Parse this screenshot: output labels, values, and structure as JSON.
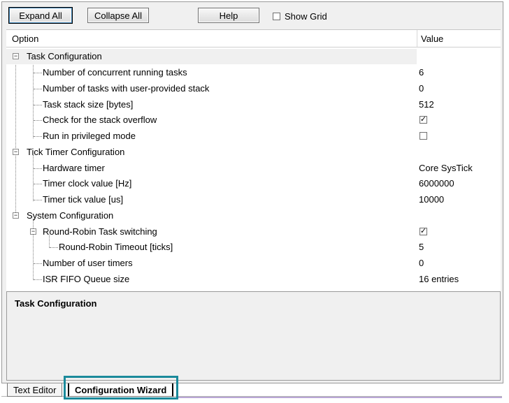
{
  "toolbar": {
    "expand_all": "Expand All",
    "collapse_all": "Collapse All",
    "help": "Help",
    "show_grid": "Show Grid",
    "show_grid_checked": false
  },
  "grid": {
    "col_option": "Option",
    "col_value": "Value",
    "rows": [
      {
        "label": "Task Configuration",
        "value": ""
      },
      {
        "label": "Number of concurrent running tasks",
        "value": "6"
      },
      {
        "label": "Number of tasks with user-provided stack",
        "value": "0"
      },
      {
        "label": "Task stack size [bytes]",
        "value": "512"
      },
      {
        "label": "Check for the stack overflow",
        "checked": true
      },
      {
        "label": "Run in privileged mode",
        "checked": false
      },
      {
        "label": "Tick Timer Configuration",
        "value": ""
      },
      {
        "label": "Hardware timer",
        "value": "Core SysTick"
      },
      {
        "label": "Timer clock value [Hz]",
        "value": "6000000"
      },
      {
        "label": "Timer tick value [us]",
        "value": "10000"
      },
      {
        "label": "System Configuration",
        "value": ""
      },
      {
        "label": "Round-Robin Task switching",
        "checked": true
      },
      {
        "label": "Round-Robin Timeout [ticks]",
        "value": "5"
      },
      {
        "label": "Number of user timers",
        "value": "0"
      },
      {
        "label": "ISR FIFO Queue size",
        "value": "16 entries"
      }
    ]
  },
  "description": {
    "title": "Task Configuration"
  },
  "tabs": [
    {
      "label": "Text Editor",
      "active": false
    },
    {
      "label": "Configuration Wizard",
      "active": true
    }
  ],
  "glyphs": {
    "check": "✓",
    "minus": "−"
  },
  "colors": {
    "highlight": "#1b8a9b"
  }
}
